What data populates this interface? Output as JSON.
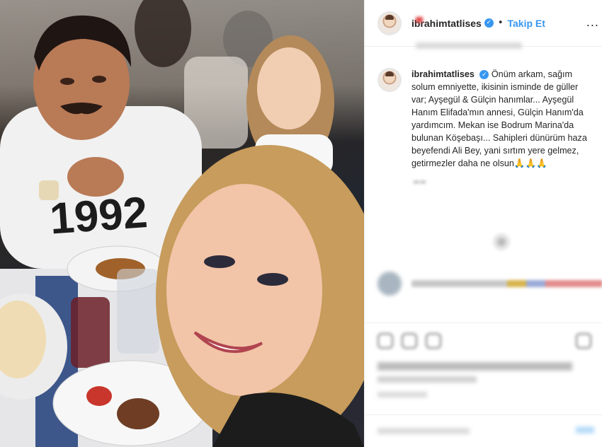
{
  "header": {
    "username": "ibrahimtatlises",
    "separator": "•",
    "follow_label": "Takip Et",
    "more_label": "..."
  },
  "caption": {
    "username": "ibrahimtatlises",
    "text": "Önüm arkam, sağım solum emniyette, ikisinin isminde de güller var; Ayşegül & Gülçin hanımlar... Ayşegül Hanım Elifada'mın annesi, Gülçin Hanım'da yardımcım. Mekan ise Bodrum Marina'da bulunan Köşebaşı... Sahipleri dünürüm haza beyefendi Ali Bey, yani sırtım yere gelmez, getirmezler daha ne olsun🙏🙏🙏"
  },
  "shirt_text": "1992",
  "icons": {
    "verified": "verified-badge-icon",
    "more": "more-horizontal-icon"
  },
  "colors": {
    "accent": "#3897f0",
    "text": "#262626",
    "border": "#efefef"
  }
}
